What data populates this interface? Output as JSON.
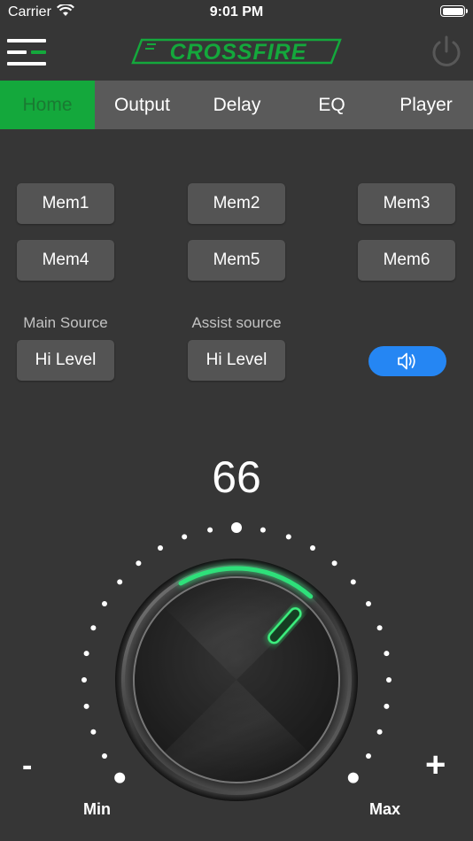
{
  "status_bar": {
    "carrier": "Carrier",
    "time": "9:01 PM"
  },
  "header": {
    "logo_text": "CROSSFIRE",
    "menu_icon": "menu-icon",
    "power_icon": "power-icon"
  },
  "tabs": [
    {
      "label": "Home",
      "active": true
    },
    {
      "label": "Output"
    },
    {
      "label": "Delay"
    },
    {
      "label": "EQ"
    },
    {
      "label": "Player"
    }
  ],
  "memory_buttons": [
    "Mem1",
    "Mem2",
    "Mem3",
    "Mem4",
    "Mem5",
    "Mem6"
  ],
  "sources": {
    "main_label": "Main Source",
    "main_value": "Hi Level",
    "assist_label": "Assist source",
    "assist_value": "Hi Level",
    "speaker_icon": "speaker-icon"
  },
  "volume": {
    "value": "66",
    "min_label": "Min",
    "max_label": "Max",
    "minus": "-",
    "plus": "+",
    "level_fraction": 0.66
  },
  "colors": {
    "accent_green": "#14a83c",
    "glow_green": "#2fe07a",
    "speaker_blue": "#2586f3",
    "background": "#363636"
  }
}
